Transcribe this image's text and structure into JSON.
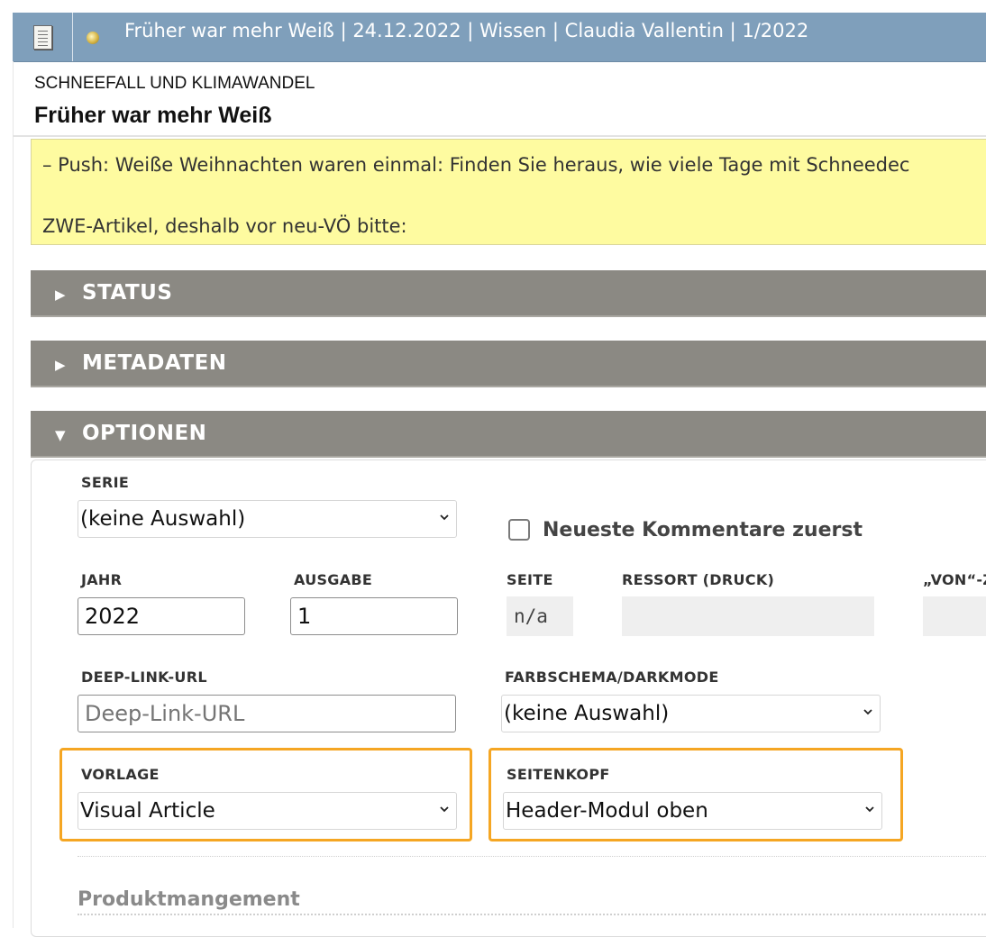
{
  "header": {
    "title": "Früher war mehr Weiß | 24.12.2022 | Wissen | Claudia Vallentin | 1/2022",
    "icons": [
      "document-icon",
      "sun-icon"
    ]
  },
  "article": {
    "kicker": "SCHNEEFALL UND KLIMAWANDEL",
    "headline": "Früher war mehr Weiß"
  },
  "note": {
    "line1": "– Push: Weiße Weihnachten waren einmal: Finden Sie heraus, wie viele Tage mit Schneedec",
    "line2": "ZWE-Artikel, deshalb vor neu-VÖ bitte:"
  },
  "sections": {
    "status": {
      "label": "STATUS",
      "icon": "▶"
    },
    "metadaten": {
      "label": "METADATEN",
      "icon": "▶"
    },
    "optionen": {
      "label": "OPTIONEN",
      "icon": "▼"
    }
  },
  "options": {
    "serie": {
      "label": "SERIE",
      "value": "(keine Auswahl)"
    },
    "comments_checkbox": {
      "label": "Neueste Kommentare zuerst",
      "checked": false
    },
    "jahr": {
      "label": "JAHR",
      "value": "2022"
    },
    "ausgabe": {
      "label": "AUSGABE",
      "value": "1"
    },
    "seite": {
      "label": "SEITE",
      "value": "n/a"
    },
    "ressort": {
      "label": "RESSORT (DRUCK)",
      "value": ""
    },
    "von": {
      "label": "„VON“-Z",
      "value": ""
    },
    "deeplink": {
      "label": "DEEP-LINK-URL",
      "placeholder": "Deep-Link-URL",
      "value": ""
    },
    "farbschema": {
      "label": "FARBSCHEMA/DARKMODE",
      "value": "(keine Auswahl)"
    },
    "vorlage": {
      "label": "VORLAGE",
      "value": "Visual Article"
    },
    "seitenkopf": {
      "label": "SEITENKOPF",
      "value": "Header-Modul oben"
    },
    "produktmanagement": {
      "label": "Produktmangement"
    }
  },
  "colors": {
    "topbar": "#7f9fbb",
    "note_bg": "#fefba0",
    "section_bg": "#8b8983",
    "highlight": "#f5a623"
  }
}
